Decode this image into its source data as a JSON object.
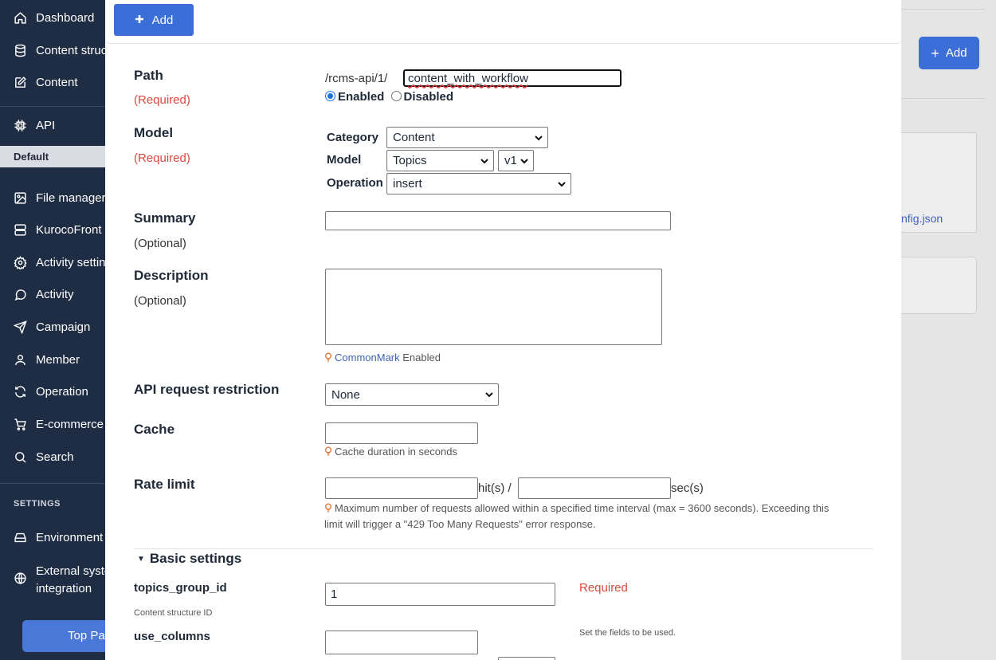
{
  "sidebar": {
    "items": [
      {
        "label": "Dashboard",
        "icon": "home-icon"
      },
      {
        "label": "Content structure",
        "icon": "database-icon"
      },
      {
        "label": "Content",
        "icon": "edit-icon"
      },
      {
        "label": "API",
        "icon": "chip-icon"
      },
      {
        "label": "File manager",
        "icon": "image-icon"
      },
      {
        "label": "KurocoFront",
        "icon": "server-icon"
      },
      {
        "label": "Activity settings",
        "icon": "gear-icon"
      },
      {
        "label": "Activity",
        "icon": "chat-icon"
      },
      {
        "label": "Campaign",
        "icon": "send-icon"
      },
      {
        "label": "Member",
        "icon": "user-icon"
      },
      {
        "label": "Operation",
        "icon": "refresh-icon"
      },
      {
        "label": "E-commerce",
        "icon": "cart-icon"
      },
      {
        "label": "Search",
        "icon": "search-icon"
      },
      {
        "label": "Environment",
        "icon": "drive-icon"
      }
    ],
    "default_label": "Default",
    "settings_label": "SETTINGS",
    "external_label_1": "External system",
    "external_label_2": "integration",
    "top_page_label": "Top Page"
  },
  "background": {
    "add_label": "Add",
    "link_text": "nfig.json"
  },
  "modal": {
    "add_label": "Add",
    "path": {
      "label": "Path",
      "required": "(Required)",
      "prefix": "/rcms-api/1/",
      "value": "content_with_workflow",
      "enabled_label": "Enabled",
      "disabled_label": "Disabled"
    },
    "model": {
      "label": "Model",
      "required": "(Required)",
      "category_label": "Category",
      "category_value": "Content",
      "model_label": "Model",
      "model_value": "Topics",
      "version_value": "v1",
      "operation_label": "Operation",
      "operation_value": "insert"
    },
    "summary": {
      "label": "Summary",
      "optional": "(Optional)",
      "value": ""
    },
    "description": {
      "label": "Description",
      "optional": "(Optional)",
      "value": "",
      "commonmark_link": "CommonMark",
      "commonmark_suffix": " Enabled"
    },
    "api_restriction": {
      "label": "API request restriction",
      "value": "None"
    },
    "cache": {
      "label": "Cache",
      "value": "",
      "hint": "Cache duration in seconds"
    },
    "rate_limit": {
      "label": "Rate limit",
      "hits_unit": "hit(s) /",
      "secs_unit": "sec(s)",
      "hint_line1": "Maximum number of requests allowed within a specified time interval (max = 3600 seconds). Exceeding this",
      "hint_line2": "limit will trigger a \"429 Too Many Requests\" error response."
    },
    "basic_settings": {
      "label": "Basic settings",
      "topics_group_id": {
        "label": "topics_group_id",
        "value": "1",
        "sublabel": "Content structure ID",
        "required": "Required"
      },
      "use_columns": {
        "label": "use_columns",
        "value": "",
        "note": "Set the fields to be used."
      }
    }
  }
}
